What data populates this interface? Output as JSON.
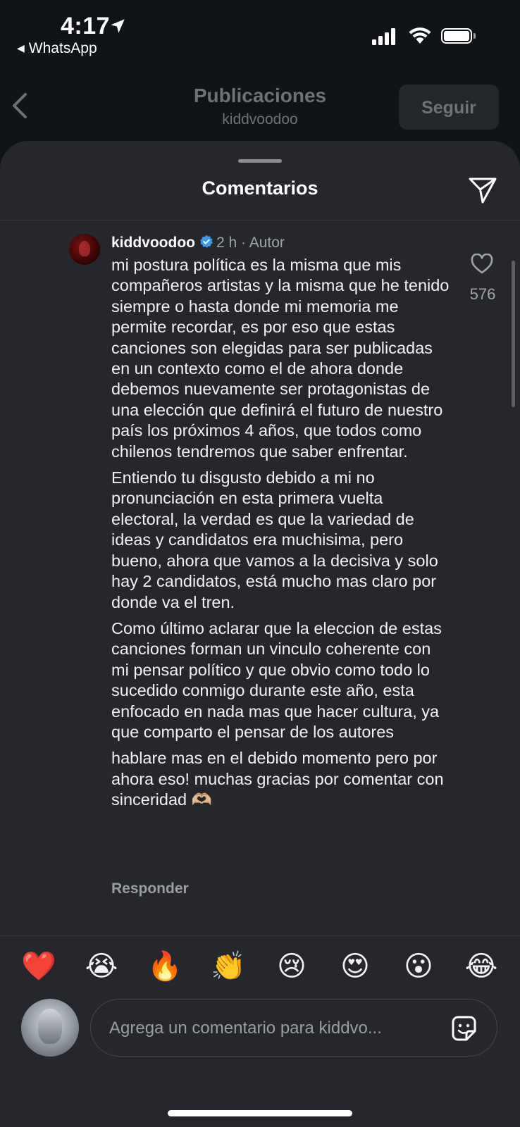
{
  "status_bar": {
    "time": "4:17",
    "back_app": "WhatsApp"
  },
  "background_header": {
    "title": "Publicaciones",
    "subtitle": "kiddvoodoo",
    "follow_button": "Seguir"
  },
  "sheet": {
    "title": "Comentarios"
  },
  "comment": {
    "username": "kiddvoodoo",
    "time": "2 h",
    "separator": "·",
    "author_tag": "Autor",
    "paragraphs": [
      "mi postura política es la misma que mis compañeros artistas y la misma que he tenido siempre o hasta donde mi memoria me permite recordar,  es por eso que estas canciones son elegidas para ser publicadas en un contexto como el de ahora donde debemos nuevamente ser protagonistas de una elección que definirá el futuro de nuestro país los próximos 4 años, que todos como chilenos tendremos que saber  enfrentar.",
      "Entiendo tu disgusto debido a mi no pronunciación en esta primera vuelta electoral, la verdad es que la variedad de ideas y candidatos era muchisima, pero bueno, ahora que vamos a la decisiva y solo hay 2 candidatos, está mucho mas claro por donde va el tren.",
      "Como último aclarar que la eleccion de estas canciones forman un vinculo coherente con mi pensar político y que obvio como todo lo sucedido conmigo durante este año, esta enfocado en nada mas que hacer cultura, ya que comparto el pensar de los autores",
      "hablare mas en el debido momento pero por ahora eso! muchas gracias por comentar con sinceridad 🫶🏼"
    ],
    "likes": "576",
    "reply_label": "Responder"
  },
  "reactions": [
    "❤️",
    "😭",
    "🔥",
    "👏",
    "😢",
    "😍",
    "😮",
    "😂"
  ],
  "composer": {
    "placeholder": "Agrega un comentario para kiddvo..."
  },
  "icons": {
    "back": "chevron-left-icon",
    "share": "paper-plane-icon",
    "like": "heart-outline-icon",
    "verified": "verified-badge-icon",
    "sticker": "sticker-icon"
  },
  "colors": {
    "sheet_bg": "#25272c",
    "page_bg": "#101317",
    "verified_blue": "#3897f0",
    "muted_text": "#a0a3aa"
  }
}
